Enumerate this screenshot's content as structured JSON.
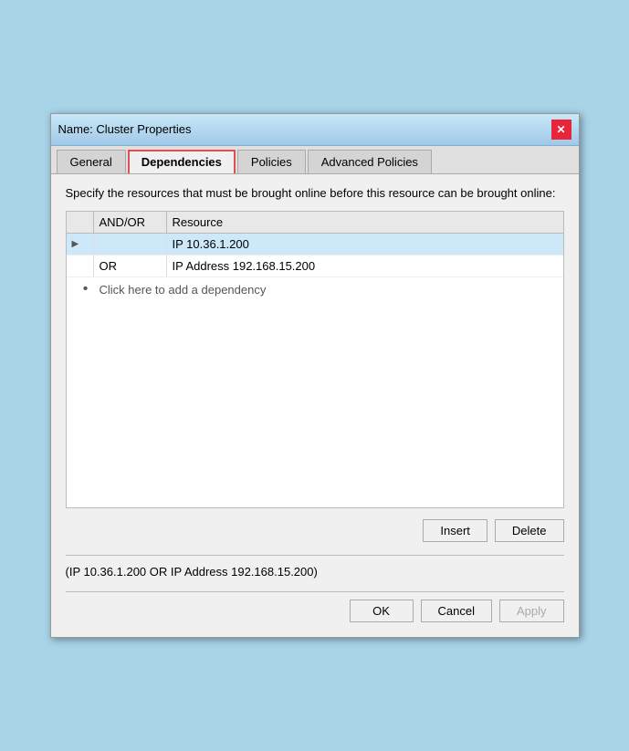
{
  "dialog": {
    "title": "Name: Cluster Properties",
    "close_label": "✕"
  },
  "tabs": [
    {
      "id": "general",
      "label": "General",
      "active": false
    },
    {
      "id": "dependencies",
      "label": "Dependencies",
      "active": true
    },
    {
      "id": "policies",
      "label": "Policies",
      "active": false
    },
    {
      "id": "advanced_policies",
      "label": "Advanced Policies",
      "active": false
    }
  ],
  "description": "Specify the resources that must be brought online before this resource can be brought online:",
  "grid": {
    "columns": [
      "",
      "AND/OR",
      "Resource"
    ],
    "rows": [
      {
        "indicator": "▶",
        "and_or": "",
        "resource": "IP 10.36.1.200",
        "selected": true
      },
      {
        "indicator": "",
        "and_or": "OR",
        "resource": "IP Address 192.168.15.200",
        "selected": false
      }
    ],
    "add_row_label": "Click here to add a dependency"
  },
  "buttons": {
    "insert": "Insert",
    "delete": "Delete",
    "ok": "OK",
    "cancel": "Cancel",
    "apply": "Apply"
  },
  "expression": "(IP 10.36.1.200  OR  IP Address 192.168.15.200)"
}
